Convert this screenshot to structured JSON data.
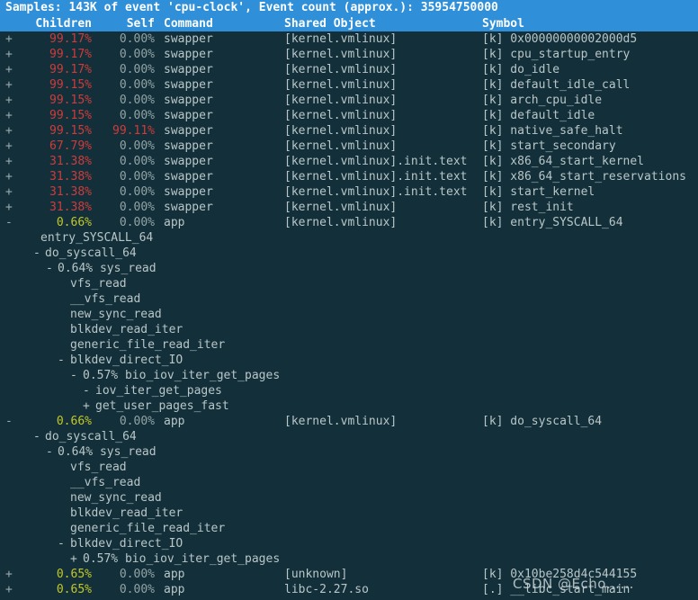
{
  "status": {
    "line": "Samples: 143K of event 'cpu-clock', Event count (approx.): 35954750000"
  },
  "columns": {
    "children": "Children",
    "self": "Self",
    "command": "Command",
    "shared_object": "Shared Object",
    "symbol": "Symbol"
  },
  "colors": {
    "header_bg": "#2f8fd8",
    "body_bg": "#13303a",
    "pct_high": "#cf3b3b",
    "pct_low": "#c3c828",
    "text": "#b9c6c8"
  },
  "rows": [
    {
      "kind": "entry",
      "fold": "+",
      "children": "99.17%",
      "pct_class": "red",
      "self": "0.00%",
      "command": "swapper",
      "dso": "[kernel.vmlinux]",
      "symbol": "[k] 0x00000000002000d5"
    },
    {
      "kind": "entry",
      "fold": "+",
      "children": "99.17%",
      "pct_class": "red",
      "self": "0.00%",
      "command": "swapper",
      "dso": "[kernel.vmlinux]",
      "symbol": "[k] cpu_startup_entry"
    },
    {
      "kind": "entry",
      "fold": "+",
      "children": "99.17%",
      "pct_class": "red",
      "self": "0.00%",
      "command": "swapper",
      "dso": "[kernel.vmlinux]",
      "symbol": "[k] do_idle"
    },
    {
      "kind": "entry",
      "fold": "+",
      "children": "99.15%",
      "pct_class": "red",
      "self": "0.00%",
      "command": "swapper",
      "dso": "[kernel.vmlinux]",
      "symbol": "[k] default_idle_call"
    },
    {
      "kind": "entry",
      "fold": "+",
      "children": "99.15%",
      "pct_class": "red",
      "self": "0.00%",
      "command": "swapper",
      "dso": "[kernel.vmlinux]",
      "symbol": "[k] arch_cpu_idle"
    },
    {
      "kind": "entry",
      "fold": "+",
      "children": "99.15%",
      "pct_class": "red",
      "self": "0.00%",
      "command": "swapper",
      "dso": "[kernel.vmlinux]",
      "symbol": "[k] default_idle"
    },
    {
      "kind": "entry",
      "fold": "+",
      "children": "99.15%",
      "pct_class": "red",
      "self": "99.11%",
      "self_class": "red",
      "command": "swapper",
      "dso": "[kernel.vmlinux]",
      "symbol": "[k] native_safe_halt"
    },
    {
      "kind": "entry",
      "fold": "+",
      "children": "67.79%",
      "pct_class": "red",
      "self": "0.00%",
      "command": "swapper",
      "dso": "[kernel.vmlinux]",
      "symbol": "[k] start_secondary"
    },
    {
      "kind": "entry",
      "fold": "+",
      "children": "31.38%",
      "pct_class": "red",
      "self": "0.00%",
      "command": "swapper",
      "dso": "[kernel.vmlinux].init.text",
      "symbol": "[k] x86_64_start_kernel"
    },
    {
      "kind": "entry",
      "fold": "+",
      "children": "31.38%",
      "pct_class": "red",
      "self": "0.00%",
      "command": "swapper",
      "dso": "[kernel.vmlinux].init.text",
      "symbol": "[k] x86_64_start_reservations"
    },
    {
      "kind": "entry",
      "fold": "+",
      "children": "31.38%",
      "pct_class": "red",
      "self": "0.00%",
      "command": "swapper",
      "dso": "[kernel.vmlinux].init.text",
      "symbol": "[k] start_kernel"
    },
    {
      "kind": "entry",
      "fold": "+",
      "children": "31.38%",
      "pct_class": "red",
      "self": "0.00%",
      "command": "swapper",
      "dso": "[kernel.vmlinux]",
      "symbol": "[k] rest_init"
    },
    {
      "kind": "entry",
      "fold": "-",
      "children": "0.66%",
      "pct_class": "olive",
      "self": "0.00%",
      "command": "app",
      "dso": "[kernel.vmlinux]",
      "symbol": "[k] entry_SYSCALL_64"
    },
    {
      "kind": "chain",
      "level": 0,
      "mark": "",
      "text": "entry_SYSCALL_64"
    },
    {
      "kind": "chain",
      "level": 1,
      "mark": "-",
      "text": "do_syscall_64"
    },
    {
      "kind": "chain",
      "level": 2,
      "mark": "-",
      "text": "0.64% sys_read"
    },
    {
      "kind": "chain",
      "level": 3,
      "mark": "",
      "text": "vfs_read"
    },
    {
      "kind": "chain",
      "level": 3,
      "mark": "",
      "text": "__vfs_read"
    },
    {
      "kind": "chain",
      "level": 3,
      "mark": "",
      "text": "new_sync_read"
    },
    {
      "kind": "chain",
      "level": 3,
      "mark": "",
      "text": "blkdev_read_iter"
    },
    {
      "kind": "chain",
      "level": 3,
      "mark": "",
      "text": "generic_file_read_iter"
    },
    {
      "kind": "chain",
      "level": 3,
      "mark": "-",
      "text": "blkdev_direct_IO"
    },
    {
      "kind": "chain",
      "level": 4,
      "mark": "-",
      "text": "0.57% bio_iov_iter_get_pages"
    },
    {
      "kind": "chain",
      "level": 5,
      "mark": "-",
      "text": "iov_iter_get_pages"
    },
    {
      "kind": "chain",
      "level": 5,
      "mark": "+",
      "text": "get_user_pages_fast"
    },
    {
      "kind": "entry",
      "fold": "-",
      "children": "0.66%",
      "pct_class": "olive",
      "self": "0.00%",
      "command": "app",
      "dso": "[kernel.vmlinux]",
      "symbol": "[k] do_syscall_64"
    },
    {
      "kind": "chain",
      "level": 1,
      "mark": "-",
      "text": "do_syscall_64"
    },
    {
      "kind": "chain",
      "level": 2,
      "mark": "-",
      "text": "0.64% sys_read"
    },
    {
      "kind": "chain",
      "level": 3,
      "mark": "",
      "text": "vfs_read"
    },
    {
      "kind": "chain",
      "level": 3,
      "mark": "",
      "text": "__vfs_read"
    },
    {
      "kind": "chain",
      "level": 3,
      "mark": "",
      "text": "new_sync_read"
    },
    {
      "kind": "chain",
      "level": 3,
      "mark": "",
      "text": "blkdev_read_iter"
    },
    {
      "kind": "chain",
      "level": 3,
      "mark": "",
      "text": "generic_file_read_iter"
    },
    {
      "kind": "chain",
      "level": 3,
      "mark": "-",
      "text": "blkdev_direct_IO"
    },
    {
      "kind": "chain",
      "level": 4,
      "mark": "+",
      "text": "0.57% bio_iov_iter_get_pages"
    },
    {
      "kind": "entry",
      "fold": "+",
      "children": "0.65%",
      "pct_class": "olive",
      "self": "0.00%",
      "command": "app",
      "dso": "[unknown]",
      "symbol": "[k] 0x10be258d4c544155"
    },
    {
      "kind": "entry",
      "fold": "+",
      "children": "0.65%",
      "pct_class": "olive",
      "self": "0.00%",
      "command": "app",
      "dso": "libc-2.27.so",
      "symbol": "[.] __libc_start_main"
    }
  ],
  "watermark": {
    "text": "CSDN @Echo……"
  }
}
